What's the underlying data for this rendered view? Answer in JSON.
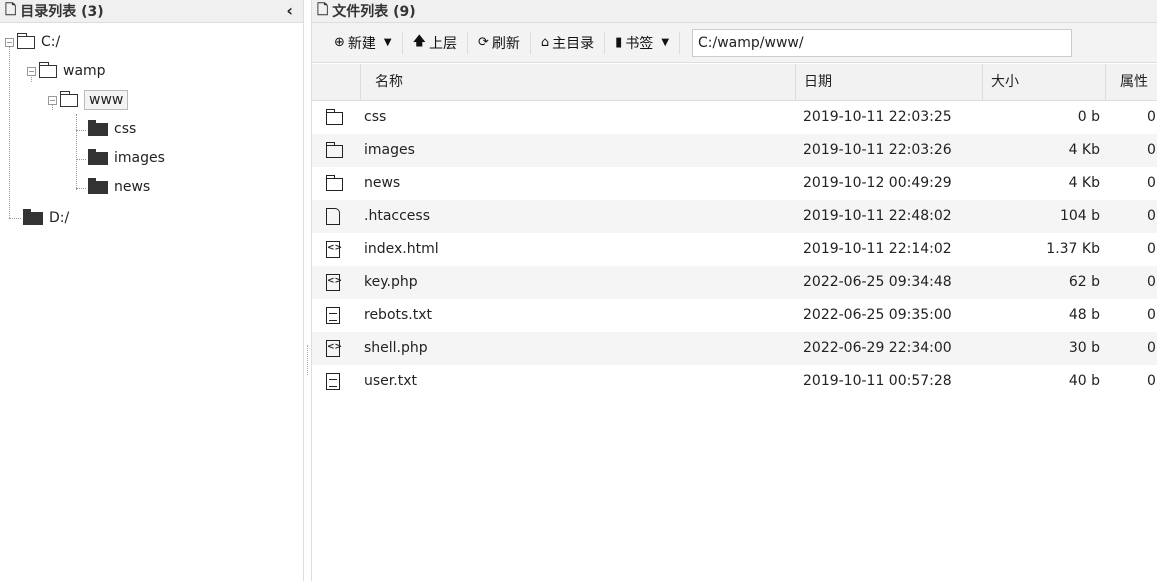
{
  "left_panel": {
    "title": "目录列表 (3)",
    "collapse_glyph": "‹",
    "tree": {
      "root_c": "C:/",
      "wamp": "wamp",
      "www": "www",
      "css": "css",
      "images": "images",
      "news": "news",
      "root_d": "D:/"
    }
  },
  "right_panel": {
    "title": "文件列表 (9)",
    "toolbar": {
      "new_label": "新建",
      "up_label": "上层",
      "refresh_label": "刷新",
      "home_label": "主目录",
      "bookmark_label": "书签",
      "path_value": "C:/wamp/www/"
    },
    "columns": {
      "name": "名称",
      "date": "日期",
      "size": "大小",
      "attr": "属性"
    },
    "files": [
      {
        "icon": "folder-icon",
        "name": "css",
        "date": "2019-10-11 22:03:25",
        "size": "0 b",
        "attr": "0"
      },
      {
        "icon": "folder-icon",
        "name": "images",
        "date": "2019-10-11 22:03:26",
        "size": "4 Kb",
        "attr": "0"
      },
      {
        "icon": "folder-icon",
        "name": "news",
        "date": "2019-10-12 00:49:29",
        "size": "4 Kb",
        "attr": "0"
      },
      {
        "icon": "file-icon",
        "name": ".htaccess",
        "date": "2019-10-11 22:48:02",
        "size": "104 b",
        "attr": "0"
      },
      {
        "icon": "code-file-icon",
        "name": "index.html",
        "date": "2019-10-11 22:14:02",
        "size": "1.37 Kb",
        "attr": "0"
      },
      {
        "icon": "code-file-icon",
        "name": "key.php",
        "date": "2022-06-25 09:34:48",
        "size": "62 b",
        "attr": "0"
      },
      {
        "icon": "text-file-icon",
        "name": "rebots.txt",
        "date": "2022-06-25 09:35:00",
        "size": "48 b",
        "attr": "0"
      },
      {
        "icon": "code-file-icon",
        "name": "shell.php",
        "date": "2022-06-29 22:34:00",
        "size": "30 b",
        "attr": "0"
      },
      {
        "icon": "text-file-icon",
        "name": "user.txt",
        "date": "2019-10-11 00:57:28",
        "size": "40 b",
        "attr": "0"
      }
    ]
  }
}
